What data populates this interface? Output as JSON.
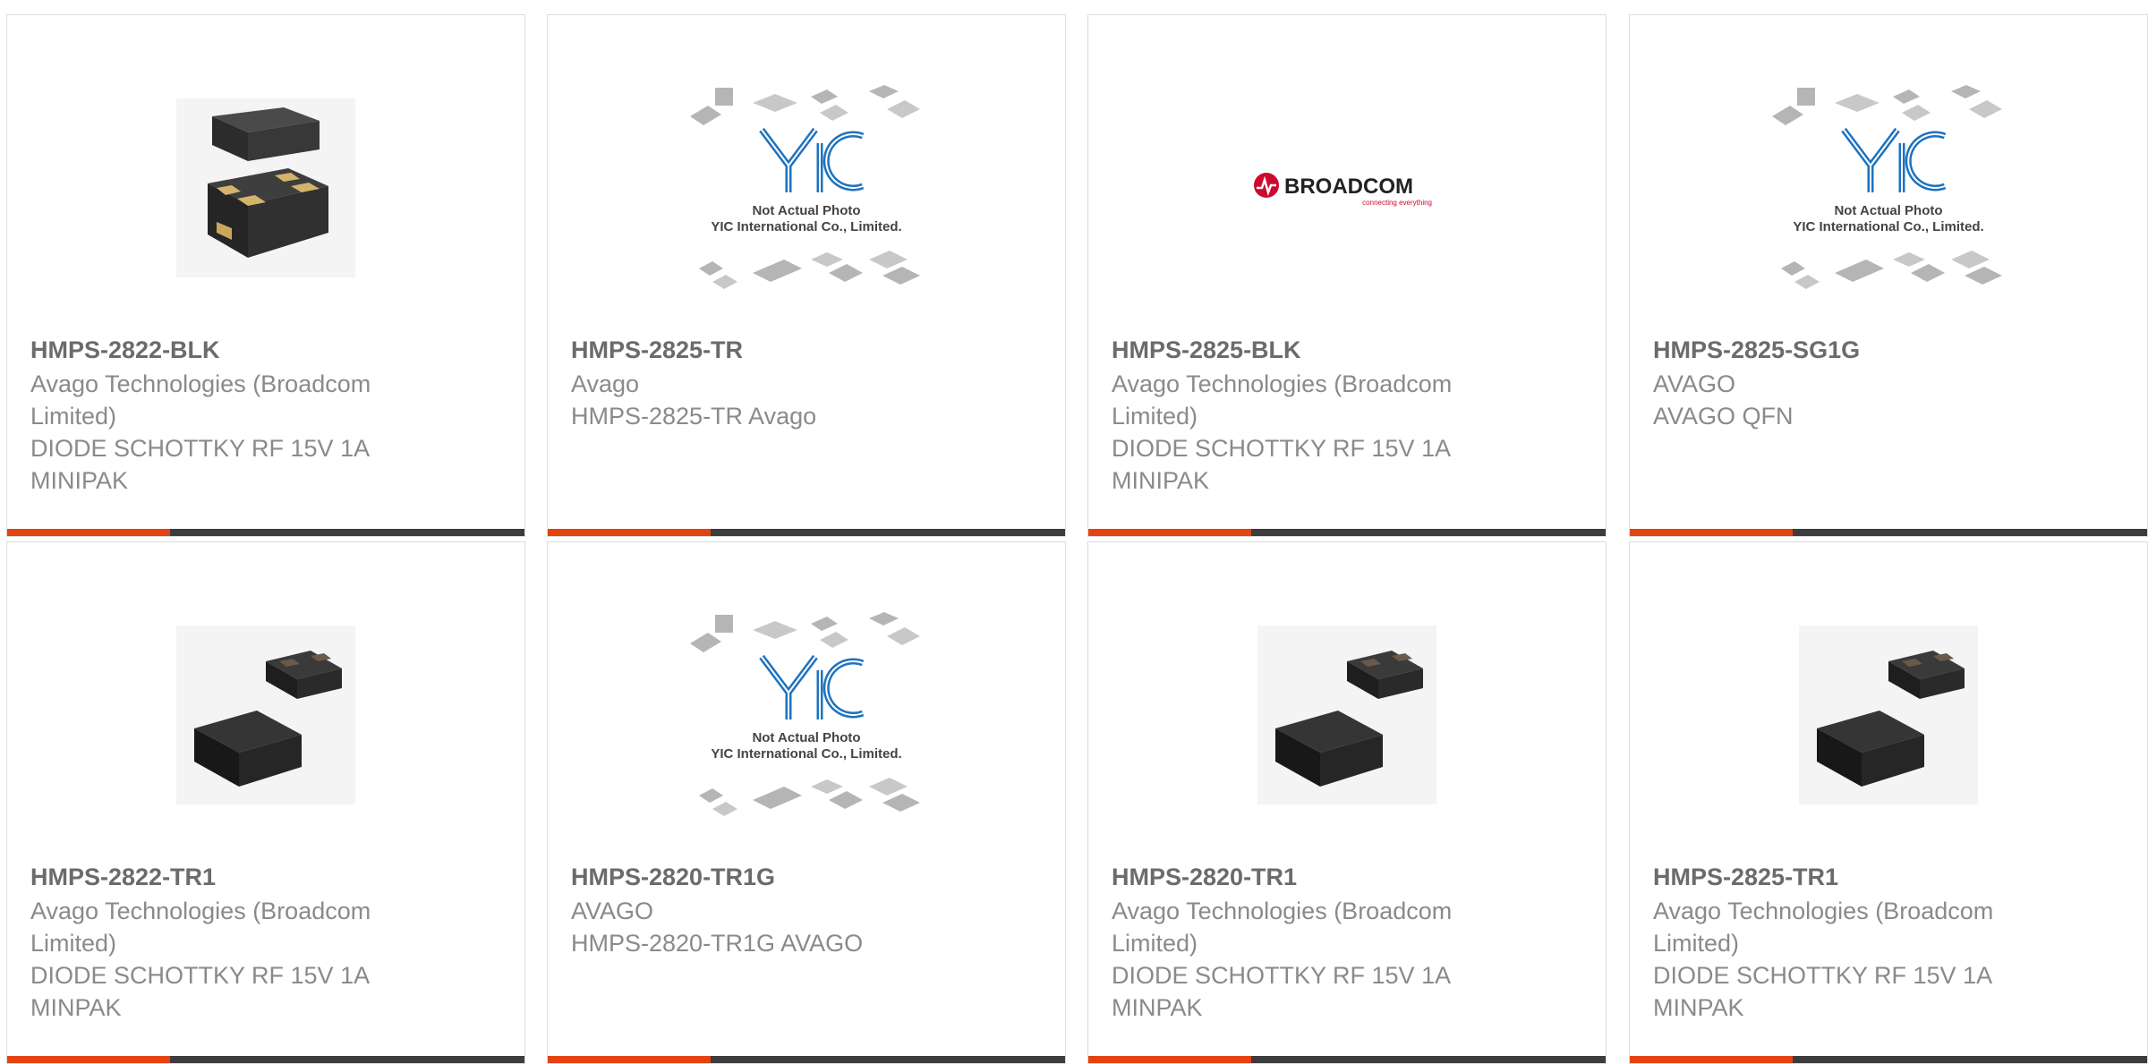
{
  "products": [
    {
      "part_number": "HMPS-2822-BLK",
      "lines": [
        "Avago Technologies (Broadcom",
        "Limited)",
        "DIODE SCHOTTKY RF 15V 1A",
        "MINIPAK"
      ],
      "image": "chip-package-image"
    },
    {
      "part_number": "HMPS-2825-TR",
      "lines": [
        "Avago",
        "HMPS-2825-TR Avago"
      ],
      "image": "yic-placeholder-image",
      "placeholder_text": [
        "Not Actual Photo",
        "YIC International Co., Limited."
      ]
    },
    {
      "part_number": "HMPS-2825-BLK",
      "lines": [
        "Avago Technologies (Broadcom",
        "Limited)",
        "DIODE SCHOTTKY RF 15V 1A",
        "MINIPAK"
      ],
      "image": "broadcom-logo",
      "logo_text": "BROADCOM",
      "logo_tagline": "connecting everything"
    },
    {
      "part_number": "HMPS-2825-SG1G",
      "lines": [
        "AVAGO",
        "AVAGO QFN"
      ],
      "image": "yic-placeholder-image",
      "placeholder_text": [
        "Not Actual Photo",
        "YIC International Co., Limited."
      ]
    },
    {
      "part_number": "HMPS-2822-TR1",
      "lines": [
        "Avago Technologies (Broadcom",
        "Limited)",
        "DIODE SCHOTTKY RF 15V 1A",
        "MINPAK"
      ],
      "image": "minipak-image"
    },
    {
      "part_number": "HMPS-2820-TR1G",
      "lines": [
        "AVAGO",
        "HMPS-2820-TR1G AVAGO"
      ],
      "image": "yic-placeholder-image",
      "placeholder_text": [
        "Not Actual Photo",
        "YIC International Co., Limited."
      ]
    },
    {
      "part_number": "HMPS-2820-TR1",
      "lines": [
        "Avago Technologies (Broadcom",
        "Limited)",
        "DIODE SCHOTTKY RF 15V 1A",
        "MINPAK"
      ],
      "image": "minipak-image"
    },
    {
      "part_number": "HMPS-2825-TR1",
      "lines": [
        "Avago Technologies (Broadcom",
        "Limited)",
        "DIODE SCHOTTKY RF 15V 1A",
        "MINPAK"
      ],
      "image": "minipak-image"
    }
  ],
  "colors": {
    "accent": "#e4420f",
    "bar": "#3c3c3c",
    "yic_blue": "#1e73be",
    "broadcom_red": "#cc092f"
  }
}
